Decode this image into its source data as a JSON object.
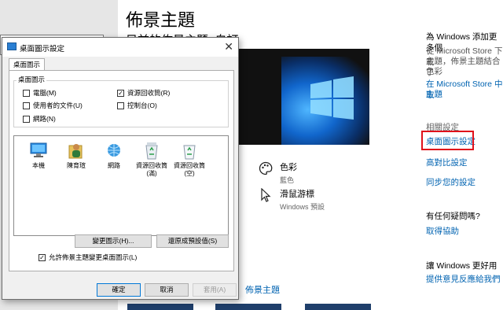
{
  "settings": {
    "page_title": "佈景主題",
    "current_theme": "目前的佈景主題: 自訂",
    "options": [
      {
        "icon": "palette-icon",
        "label": "色彩",
        "value": "藍色"
      },
      {
        "icon": "cursor-icon",
        "label": "滑鼠游標",
        "value": "Windows 預設"
      }
    ],
    "bottom_link": "佈景主題",
    "right": {
      "store_heading": "為 Windows 添加更多個",
      "store_desc": [
        "從 Microsoft Store 下載",
        "主題，佈景主題結合了",
        "色彩"
      ],
      "store_link": [
        "在 Microsoft Store 中取",
        "主題"
      ],
      "related_heading": "相關設定",
      "related_links": [
        "桌面圖示設定",
        "高對比設定",
        "同步您的設定"
      ],
      "help_heading": "有任何疑問嗎?",
      "help_link": "取得協助",
      "improve_heading": "讓 Windows 更好用",
      "improve_link": "提供意見反應給我們"
    },
    "highlight_color": "#e0101a",
    "link_color": "#0063b1"
  },
  "dialog": {
    "title": "桌面圖示設定",
    "tab": "桌面圖示",
    "group_label": "桌面圖示",
    "checkboxes": [
      {
        "label": "電腦(M)",
        "checked": false
      },
      {
        "label": "資源回收筒(R)",
        "checked": true
      },
      {
        "label": "使用者的文件(U)",
        "checked": false
      },
      {
        "label": "控制台(O)",
        "checked": false
      },
      {
        "label": "網路(N)",
        "checked": false
      }
    ],
    "icons": [
      {
        "icon": "computer-icon",
        "label": "本機"
      },
      {
        "icon": "user-folder-icon",
        "label": "陳育瑄"
      },
      {
        "icon": "network-icon",
        "label": "網路"
      },
      {
        "icon": "recycle-bin-full-icon",
        "label": "資源回收筒 (滿)"
      },
      {
        "icon": "recycle-bin-empty-icon",
        "label": "資源回收筒 (空)"
      }
    ],
    "change_icon_button": "變更圖示(H)...",
    "restore_default_button": "還原成預設值(S)",
    "allow_themes_label": "允許佈景主題變更桌面圖示(L)",
    "allow_themes_checked": true,
    "ok_button": "確定",
    "cancel_button": "取消",
    "apply_button": "套用(A)"
  }
}
